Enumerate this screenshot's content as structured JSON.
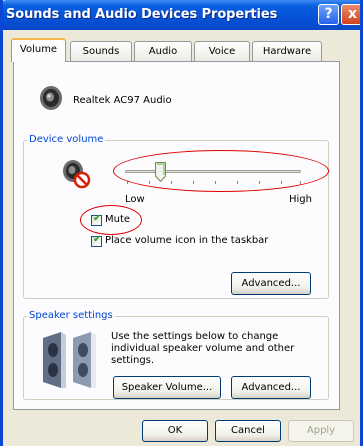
{
  "window": {
    "title": "Sounds and Audio Devices Properties",
    "help_label": "?",
    "close_label": "x"
  },
  "tabs": [
    {
      "label": "Volume",
      "active": true
    },
    {
      "label": "Sounds",
      "active": false
    },
    {
      "label": "Audio",
      "active": false
    },
    {
      "label": "Voice",
      "active": false
    },
    {
      "label": "Hardware",
      "active": false
    }
  ],
  "device": {
    "name": "Realtek AC97 Audio",
    "icon": "speaker-icon"
  },
  "device_volume": {
    "group_label": "Device volume",
    "low_label": "Low",
    "high_label": "High",
    "level_percent": 20,
    "mute_label": "Mute",
    "mute_checked": true,
    "taskbar_label": "Place volume icon in the taskbar",
    "taskbar_checked": true,
    "advanced_label": "Advanced...",
    "muted_icon": "muted-speaker-icon"
  },
  "speaker_settings": {
    "group_label": "Speaker settings",
    "description": "Use the settings below to change individual speaker volume and other settings.",
    "speaker_volume_label": "Speaker Volume...",
    "advanced_label": "Advanced...",
    "icon": "speakers-icon"
  },
  "footer": {
    "ok_label": "OK",
    "cancel_label": "Cancel",
    "apply_label": "Apply",
    "apply_enabled": false
  },
  "colors": {
    "title_bar": "#0a5ee0",
    "group_label": "#0046d5",
    "annotation": "#e00000"
  }
}
